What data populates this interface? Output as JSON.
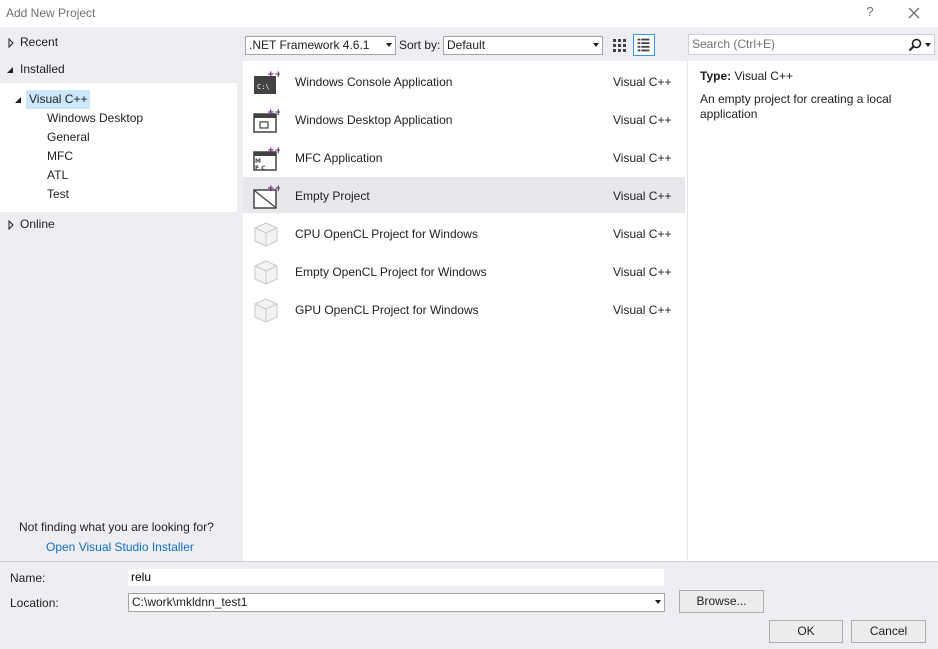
{
  "window": {
    "title": "Add New Project",
    "help": "?"
  },
  "tree": {
    "recent": "Recent",
    "installed": "Installed",
    "visual_cpp": "Visual C++",
    "children": [
      "Windows Desktop",
      "General",
      "MFC",
      "ATL",
      "Test"
    ],
    "online": "Online",
    "not_finding": "Not finding what you are looking for?",
    "installer_link": "Open Visual Studio Installer"
  },
  "toolbar": {
    "framework": ".NET Framework 4.6.1",
    "sort_label": "Sort by:",
    "sort_value": "Default",
    "search_placeholder": "Search (Ctrl+E)"
  },
  "templates": [
    {
      "name": "Windows Console Application",
      "lang": "Visual C++",
      "icon": "console-app-icon"
    },
    {
      "name": "Windows Desktop Application",
      "lang": "Visual C++",
      "icon": "desktop-app-icon"
    },
    {
      "name": "MFC Application",
      "lang": "Visual C++",
      "icon": "mfc-app-icon"
    },
    {
      "name": "Empty Project",
      "lang": "Visual C++",
      "icon": "empty-project-icon",
      "selected": true
    },
    {
      "name": "CPU OpenCL Project for Windows",
      "lang": "Visual C++",
      "icon": "opencl-cube-icon"
    },
    {
      "name": "Empty OpenCL Project for Windows",
      "lang": "Visual C++",
      "icon": "opencl-cube-icon"
    },
    {
      "name": "GPU OpenCL Project for Windows",
      "lang": "Visual C++",
      "icon": "opencl-cube-icon"
    }
  ],
  "details": {
    "type_label": "Type:",
    "type_value": "Visual C++",
    "description": "An empty project for creating a local application"
  },
  "form": {
    "name_label": "Name:",
    "name_value": "relu",
    "location_label": "Location:",
    "location_value": "C:\\work\\mkldnn_test1",
    "browse": "Browse...",
    "ok": "OK",
    "cancel": "Cancel"
  },
  "colors": {
    "accent": "#3399ff",
    "selection": "#cce8ff",
    "link": "#0e70c0",
    "cpp_purple": "#68217a"
  }
}
